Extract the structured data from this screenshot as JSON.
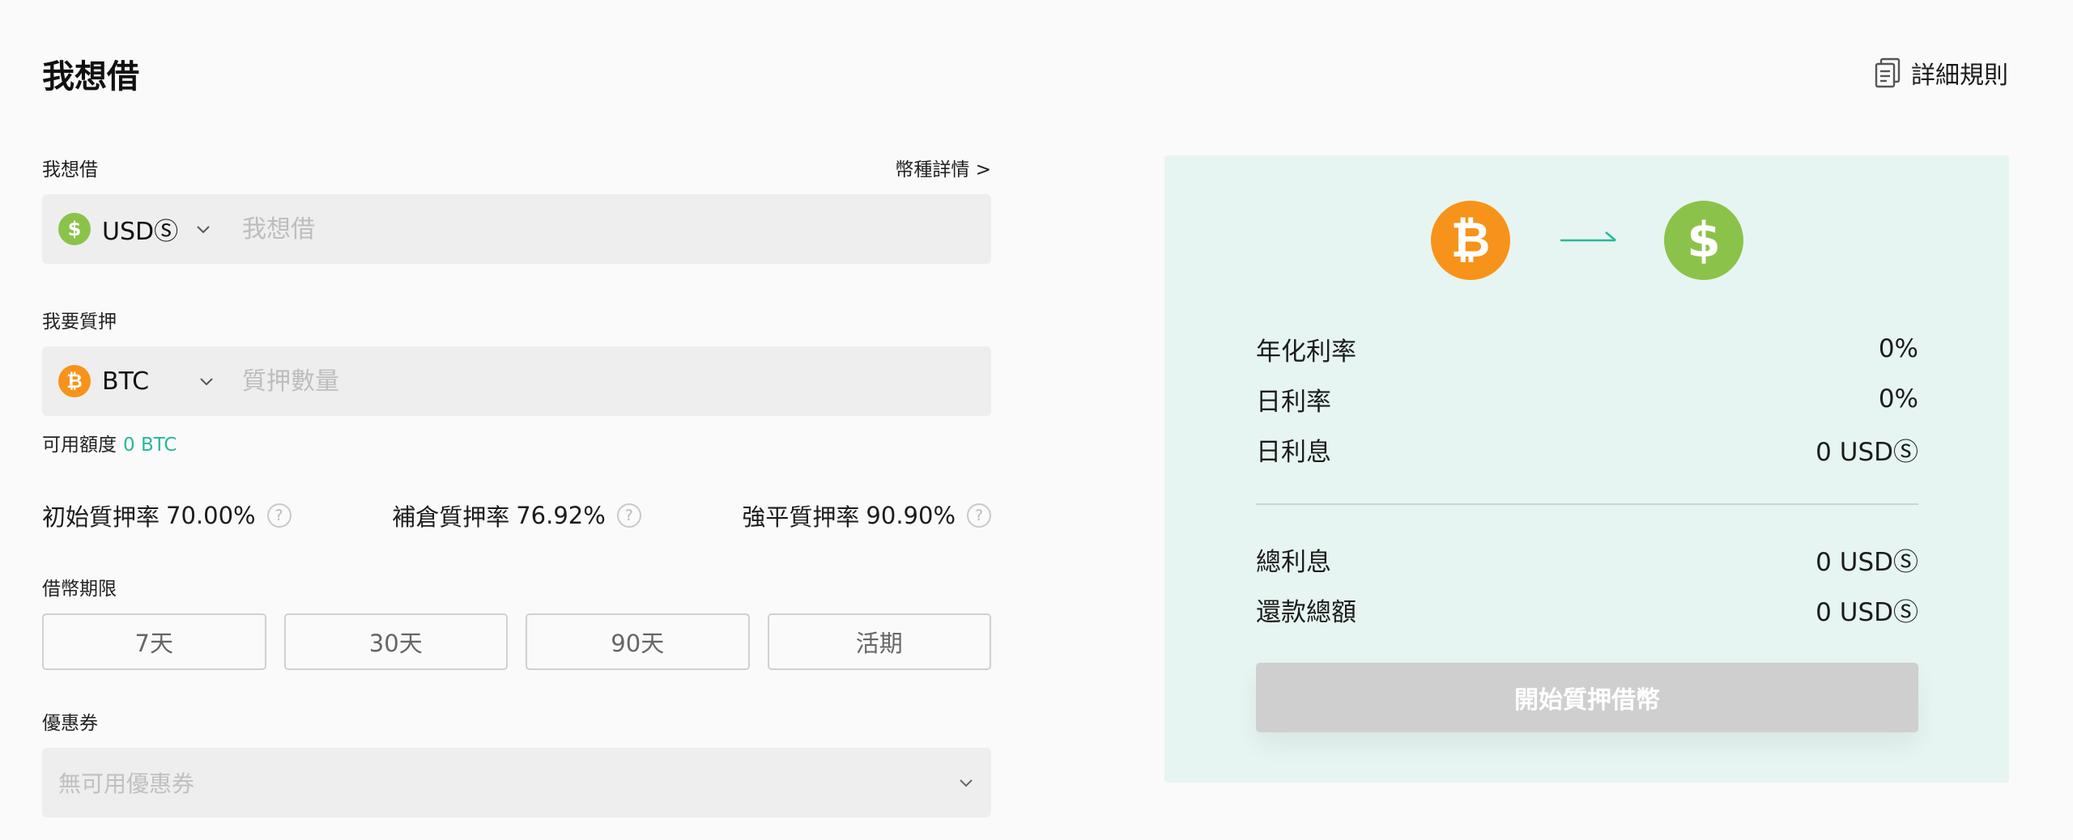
{
  "header": {
    "title": "我想借",
    "rules_label": "詳細規則",
    "rules_icon": "document-icon"
  },
  "borrow": {
    "label": "我想借",
    "coin_details_label": "幣種詳情 >",
    "coin": "USDⓈ",
    "coin_icon": "dollar-coin-icon",
    "placeholder": "我想借",
    "value": ""
  },
  "collateral": {
    "label": "我要質押",
    "coin": "BTC",
    "coin_icon": "bitcoin-icon",
    "placeholder": "質押數量",
    "value": "",
    "available_label": "可用額度",
    "available_value": "0 BTC"
  },
  "ratios": [
    {
      "label": "初始質押率",
      "value": "70.00%"
    },
    {
      "label": "補倉質押率",
      "value": "76.92%"
    },
    {
      "label": "強平質押率",
      "value": "90.90%"
    }
  ],
  "term": {
    "label": "借幣期限",
    "options": [
      "7天",
      "30天",
      "90天",
      "活期"
    ]
  },
  "coupon": {
    "label": "優惠券",
    "value": "無可用優惠券"
  },
  "summary": {
    "rows_top": [
      {
        "label": "年化利率",
        "value": "0%"
      },
      {
        "label": "日利率",
        "value": "0%"
      },
      {
        "label": "日利息",
        "value": "0 USDⓈ"
      }
    ],
    "rows_bottom": [
      {
        "label": "總利息",
        "value": "0 USDⓈ"
      },
      {
        "label": "還款總額",
        "value": "0 USDⓈ"
      }
    ],
    "submit_label": "開始質押借幣"
  },
  "colors": {
    "accent": "#26b89a",
    "btc": "#f7931a",
    "usd": "#8bc34a",
    "panel_bg": "#e6f5f1",
    "disabled_button": "#cfcfcf"
  }
}
